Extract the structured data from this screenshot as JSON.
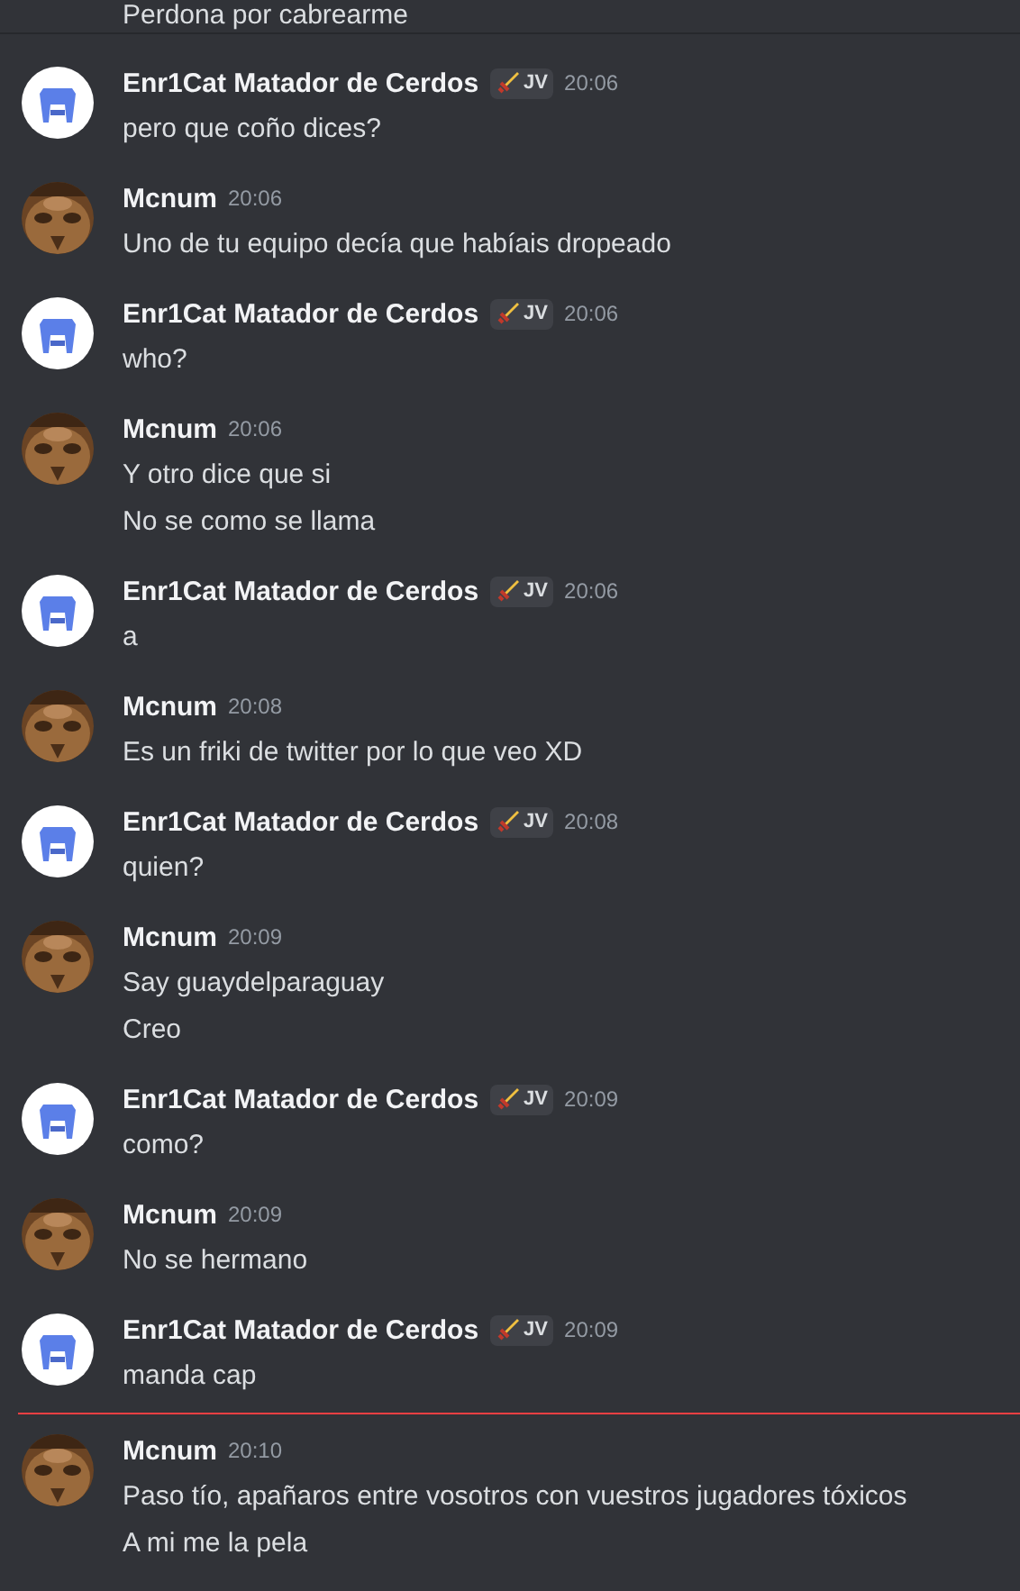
{
  "top_message": "Perdona por cabrearme",
  "groups": [
    {
      "author": "Enr1Cat Matador de Cerdos",
      "kind": "stool",
      "tag": "JV",
      "time": "20:06",
      "new_divider": false,
      "messages": [
        "pero que coño dices?"
      ]
    },
    {
      "author": "Mcnum",
      "kind": "picture",
      "time": "20:06",
      "new_divider": false,
      "messages": [
        "Uno de tu equipo decía que habíais dropeado"
      ]
    },
    {
      "author": "Enr1Cat Matador de Cerdos",
      "kind": "stool",
      "tag": "JV",
      "time": "20:06",
      "new_divider": false,
      "messages": [
        "who?"
      ]
    },
    {
      "author": "Mcnum",
      "kind": "picture",
      "time": "20:06",
      "new_divider": false,
      "messages": [
        "Y otro dice que si",
        "No se como se llama"
      ]
    },
    {
      "author": "Enr1Cat Matador de Cerdos",
      "kind": "stool",
      "tag": "JV",
      "time": "20:06",
      "new_divider": false,
      "messages": [
        "a"
      ]
    },
    {
      "author": "Mcnum",
      "kind": "picture",
      "time": "20:08",
      "new_divider": false,
      "messages": [
        "Es un friki de twitter por lo que veo XD"
      ]
    },
    {
      "author": "Enr1Cat Matador de Cerdos",
      "kind": "stool",
      "tag": "JV",
      "time": "20:08",
      "new_divider": false,
      "messages": [
        "quien?"
      ]
    },
    {
      "author": "Mcnum",
      "kind": "picture",
      "time": "20:09",
      "new_divider": false,
      "messages": [
        "Say guaydelparaguay",
        "Creo"
      ]
    },
    {
      "author": "Enr1Cat Matador de Cerdos",
      "kind": "stool",
      "tag": "JV",
      "time": "20:09",
      "new_divider": false,
      "messages": [
        "como?"
      ]
    },
    {
      "author": "Mcnum",
      "kind": "picture",
      "time": "20:09",
      "new_divider": false,
      "messages": [
        "No se hermano"
      ]
    },
    {
      "author": "Enr1Cat Matador de Cerdos",
      "kind": "stool",
      "tag": "JV",
      "time": "20:09",
      "new_divider": false,
      "messages": [
        "manda cap"
      ]
    },
    {
      "author": "Mcnum",
      "kind": "picture",
      "time": "20:10",
      "new_divider": true,
      "messages": [
        "Paso tío, apañaros entre vosotros con vuestros jugadores tóxicos",
        "A mi me la pela"
      ]
    }
  ]
}
